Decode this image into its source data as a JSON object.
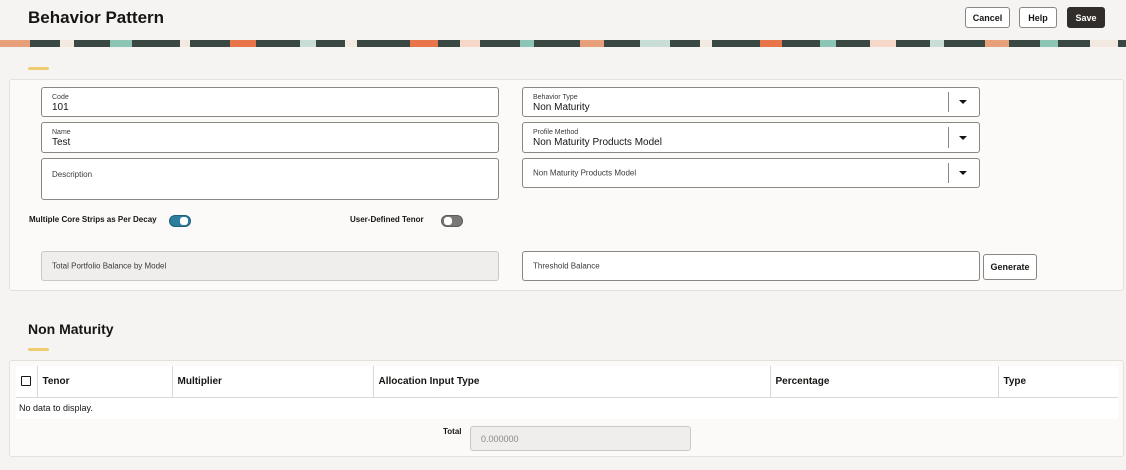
{
  "header": {
    "title": "Behavior Pattern",
    "buttons": {
      "cancel": "Cancel",
      "help": "Help",
      "save": "Save"
    }
  },
  "form": {
    "code": {
      "label": "Code",
      "value": "101"
    },
    "name": {
      "label": "Name",
      "value": "Test"
    },
    "description": {
      "label": "Description",
      "value": ""
    },
    "behavior_type": {
      "label": "Behavior Type",
      "value": "Non Maturity"
    },
    "profile_method": {
      "label": "Profile Method",
      "value": "Non Maturity Products Model"
    },
    "products_model": {
      "label": "Non Maturity Products Model",
      "value": ""
    },
    "multiple_core_strips": {
      "label": "Multiple Core Strips as Per Decay",
      "on": true
    },
    "user_defined_tenor": {
      "label": "User-Defined Tenor",
      "on": false
    },
    "total_portfolio_balance": {
      "label": "Total Portfolio Balance by Model"
    },
    "threshold_balance": {
      "label": "Threshold Balance"
    },
    "generate_label": "Generate"
  },
  "non_maturity": {
    "title": "Non Maturity",
    "columns": [
      "Tenor",
      "Multiplier",
      "Allocation Input Type",
      "Percentage",
      "Type"
    ],
    "empty_text": "No data to display.",
    "total_label": "Total",
    "total_value": "0.000000"
  },
  "colors": {
    "accent": "#f0cc71",
    "toggle_on": "#2d7f9e",
    "primary_button": "#312d2a"
  }
}
